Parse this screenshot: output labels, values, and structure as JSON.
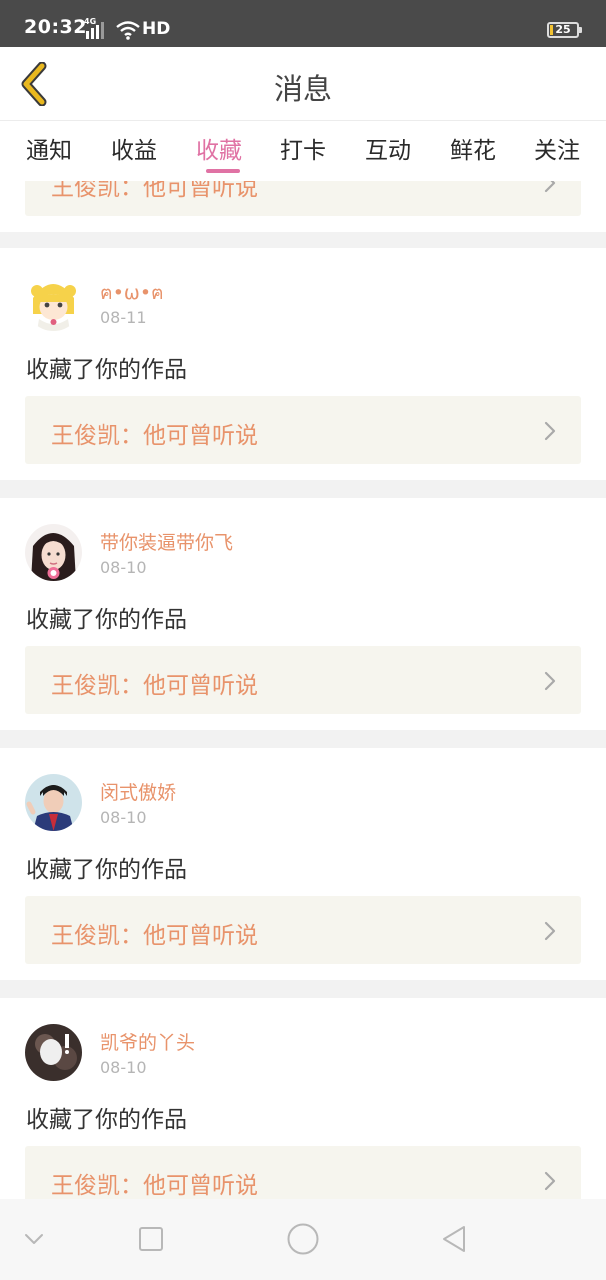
{
  "status_bar": {
    "time": "20:32",
    "network": "4G",
    "hd_label": "HD",
    "battery": "25",
    "signal_icon": "signal-bars-icon",
    "wifi_icon": "wifi-icon"
  },
  "header": {
    "title": "消息",
    "back_icon": "chevron-left-icon"
  },
  "colors": {
    "accent": "#e072a4",
    "name_color": "#e8936b",
    "back_arrow": "#e9b81f",
    "card_bg": "#f6f5ee"
  },
  "tabs": [
    {
      "label": "通知"
    },
    {
      "label": "收益"
    },
    {
      "label": "收藏",
      "active": true
    },
    {
      "label": "打卡"
    },
    {
      "label": "互动"
    },
    {
      "label": "鲜花"
    },
    {
      "label": "关注"
    }
  ],
  "items": [
    {
      "name": "",
      "date": "",
      "action": "",
      "work_title": "王俊凯：他可曾听说"
    },
    {
      "name": "ฅ•ω•ฅ",
      "date": "08-11",
      "action": "收藏了你的作品",
      "work_title": "王俊凯：他可曾听说"
    },
    {
      "name": "带你装逼带你飞",
      "date": "08-10",
      "action": "收藏了你的作品",
      "work_title": "王俊凯：他可曾听说"
    },
    {
      "name": "闵式傲娇",
      "date": "08-10",
      "action": "收藏了你的作品",
      "work_title": "王俊凯：他可曾听说"
    },
    {
      "name": "凯爷的丫头",
      "date": "08-10",
      "action": "收藏了你的作品",
      "work_title": "王俊凯：他可曾听说"
    }
  ],
  "navbar": {
    "icons": [
      "chevron-down-icon",
      "square-icon",
      "circle-icon",
      "triangle-back-icon"
    ]
  }
}
